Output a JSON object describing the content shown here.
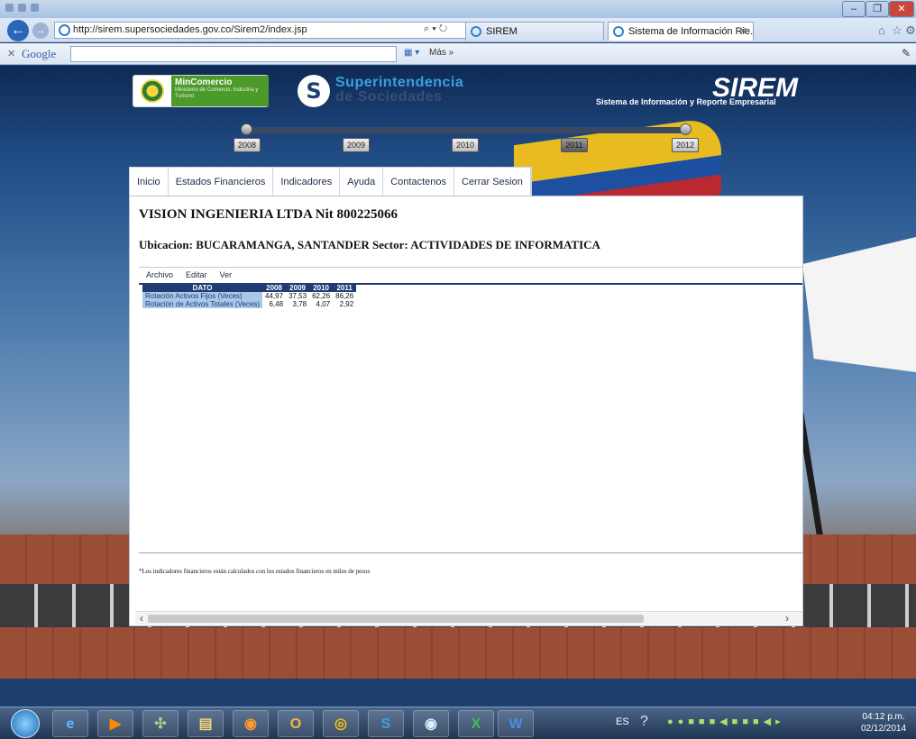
{
  "browser": {
    "url": "http://sirem.supersociedades.gov.co/Sirem2/index.jsp",
    "tabs": [
      "SIREM",
      "Sistema de Información Rie..."
    ],
    "google_label": "Google",
    "mas_label": "Más »"
  },
  "header": {
    "mincomercio_title": "MinComercio",
    "mincomercio_sub": "Ministerio de Comercio, Industria y Turismo",
    "super_line1": "Superintendencia",
    "super_line2": "de Sociedades",
    "sirem_title": "SIREM",
    "sirem_subtitle": "Sistema de Información y Reporte Empresarial"
  },
  "timeline": {
    "years": [
      "2008",
      "2009",
      "2010",
      "2011",
      "2012"
    ],
    "selected": "2011"
  },
  "menu": {
    "items": [
      "Inicio",
      "Estados Financieros",
      "Indicadores",
      "Ayuda",
      "Contactenos",
      "Cerrar Sesion"
    ]
  },
  "company": {
    "name": "VISION INGENIERIA LTDA Nit 800225066",
    "location": "Ubicacion: BUCARAMANGA, SANTANDER Sector: ACTIVIDADES DE INFORMATICA"
  },
  "filemenu": [
    "Archivo",
    "Editar",
    "Ver"
  ],
  "table": {
    "headers": [
      "DATO",
      "2008",
      "2009",
      "2010",
      "2011"
    ],
    "rows": [
      {
        "label": "Rotación Activos Fijos (Veces)",
        "values": [
          "44,97",
          "37,53",
          "62,26",
          "86,26"
        ]
      },
      {
        "label": "Rotación de Activos Totales (Veces)",
        "values": [
          "6,48",
          "3,78",
          "4,07",
          "2,92"
        ]
      }
    ]
  },
  "footnote": "*Los indicadores financieros están calculados con los estados financieros en miles de pesos",
  "taskbar": {
    "lang": "ES",
    "time": "04:12 p.m.",
    "date": "02/12/2014"
  }
}
